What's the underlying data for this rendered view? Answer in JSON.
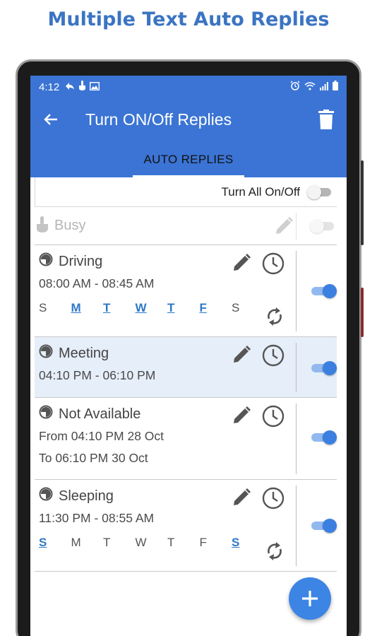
{
  "headline": "Multiple Text Auto Replies",
  "status_bar": {
    "time": "4:12"
  },
  "app_bar": {
    "title": "Turn ON/Off Replies"
  },
  "tabs": [
    {
      "label": "AUTO REPLIES",
      "active": true
    }
  ],
  "master_toggle": {
    "label": "Turn All On/Off",
    "on": false
  },
  "replies": [
    {
      "name": "Busy",
      "disabled": true,
      "on": false
    },
    {
      "name": "Driving",
      "time": "08:00 AM - 08:45 AM",
      "on": true,
      "days": [
        "S",
        "M",
        "T",
        "W",
        "T",
        "F",
        "S"
      ],
      "active_days": [
        false,
        true,
        true,
        true,
        true,
        true,
        false
      ]
    },
    {
      "name": "Meeting",
      "time": "04:10 PM - 06:10 PM",
      "on": true,
      "selected": true
    },
    {
      "name": "Not Available",
      "from": "From 04:10 PM 28 Oct",
      "to": "To 06:10 PM 30 Oct",
      "on": true
    },
    {
      "name": "Sleeping",
      "time": "11:30 PM - 08:55 AM",
      "on": true,
      "days": [
        "S",
        "M",
        "T",
        "W",
        "T",
        "F",
        "S"
      ],
      "active_days": [
        true,
        false,
        false,
        false,
        false,
        false,
        true
      ]
    }
  ],
  "colors": {
    "primary": "#3b74d4",
    "accent": "#3b7fe0",
    "headline": "#3b74c2",
    "selected_row": "#e6eef9"
  },
  "icons": [
    "back-arrow-icon",
    "delete-icon",
    "touch-icon",
    "pencil-icon",
    "clock-icon",
    "repeat-icon",
    "timer-icon",
    "add-icon"
  ]
}
